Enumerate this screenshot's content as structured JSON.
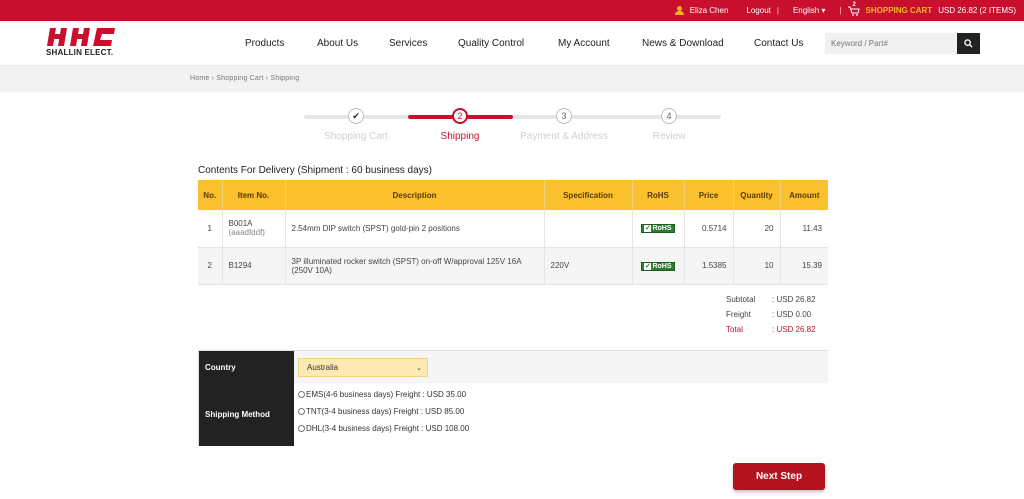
{
  "topbar": {
    "user_name": "Eliza Chen",
    "logout": "Logout",
    "separator": "|",
    "language": "English",
    "language_caret": "▾",
    "cart_count": "2",
    "cart_label": "SHOPPING CART",
    "cart_summary": "USD 26.82 (2 ITEMS)"
  },
  "header": {
    "logo_text": "SHALLIN ELECT.",
    "nav": [
      "Products",
      "About Us",
      "Services",
      "Quality Control",
      "My Account",
      "News & Download",
      "Contact Us"
    ],
    "search_placeholder": "Keyword / Part#"
  },
  "breadcrumb": "Home › Shopping Cart › Shipping",
  "steps": [
    {
      "label": "Shopping Cart",
      "marker": "✔",
      "state": "done"
    },
    {
      "label": "Shipping",
      "marker": "2",
      "state": "active"
    },
    {
      "label": "Payment & Address",
      "marker": "3",
      "state": "pending"
    },
    {
      "label": "Review",
      "marker": "4",
      "state": "pending"
    }
  ],
  "section_title": "Contents For Delivery (Shipment  :  60 business days)",
  "table": {
    "headers": [
      "No.",
      "Item No.",
      "Description",
      "Specification",
      "RoHS",
      "Price",
      "Quantity",
      "Amount"
    ],
    "rows": [
      {
        "no": "1",
        "item": "B001A",
        "item_sub": "(aaadfddf)",
        "description": "2.54mm DIP switch (SPST) gold-pin 2 positions",
        "spec": "",
        "rohs": "RoHS",
        "price": "0.5714",
        "qty": "20",
        "amount": "11.43"
      },
      {
        "no": "2",
        "item": "B1294",
        "item_sub": "",
        "description": "3P illuminated rocker switch (SPST) on-off W/approval 125V 16A (250V 10A)",
        "spec": "220V",
        "rohs": "RoHS",
        "price": "1.5385",
        "qty": "10",
        "amount": "15.39"
      }
    ]
  },
  "totals": {
    "subtotal_label": "Subtotal",
    "subtotal_value": ": USD 26.82",
    "freight_label": "Freight",
    "freight_value": ": USD  0.00",
    "total_label": "Total",
    "total_value": ": USD 26.82"
  },
  "shipping": {
    "country_label": "Country",
    "country_value": "Australia",
    "method_label": "Shipping Method",
    "options": [
      "EMS(4-6 business days) Freight : USD 35.00",
      "TNT(3-4 business days) Freight : USD 85.00",
      "DHL(3-4 business days) Freight : USD 108.00"
    ]
  },
  "next_button": "Next Step",
  "colors": {
    "brand_red": "#c8102e",
    "accent_yellow": "#fbc02d",
    "rohs_green": "#2e7d32"
  }
}
